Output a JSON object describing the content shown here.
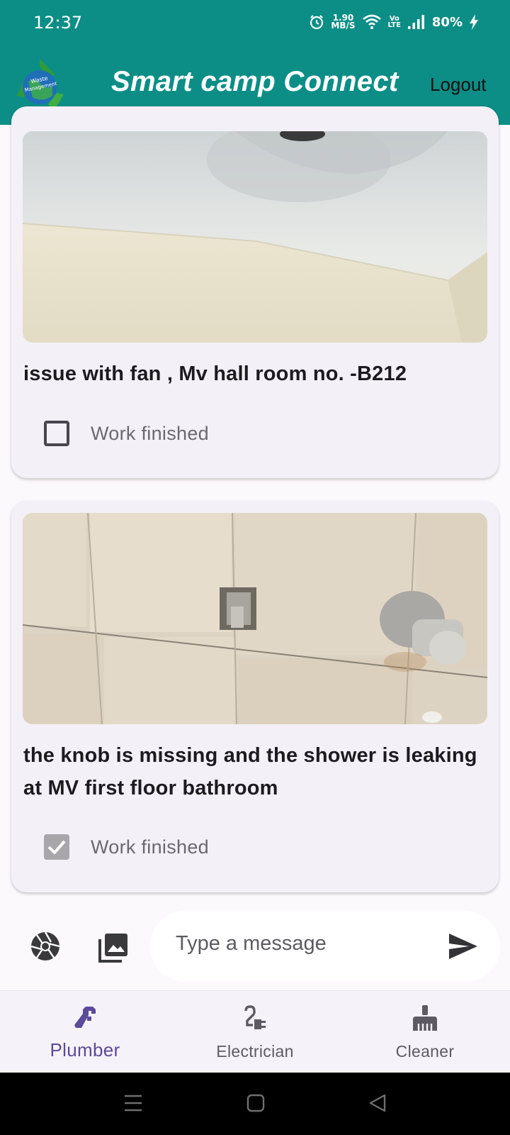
{
  "status_bar": {
    "time": "12:37",
    "speed_value": "1.90",
    "speed_unit": "MB/S",
    "volte_top": "Vo",
    "volte_bottom": "LTE",
    "battery": "80%"
  },
  "app_bar": {
    "logo_text": "Waste Management",
    "title": "Smart camp Connect",
    "logout_label": "Logout"
  },
  "cards": [
    {
      "description": "issue with fan , Mv hall room no. -B212",
      "checkbox_label": "Work finished",
      "checked": false
    },
    {
      "description": "the knob is missing and the shower is leaking at MV first floor bathroom",
      "checkbox_label": "Work finished",
      "checked": true
    }
  ],
  "composer": {
    "placeholder": "Type a message"
  },
  "bottom_nav": {
    "items": [
      {
        "label": "Plumber",
        "icon": "plumbing-icon",
        "active": true
      },
      {
        "label": "Electrician",
        "icon": "electrical-plug-icon",
        "active": false
      },
      {
        "label": "Cleaner",
        "icon": "cleaning-brush-icon",
        "active": false
      }
    ]
  },
  "colors": {
    "primary": "#0c8e86",
    "nav_active": "#5c4a9a",
    "card_bg": "#f4f0f7"
  }
}
